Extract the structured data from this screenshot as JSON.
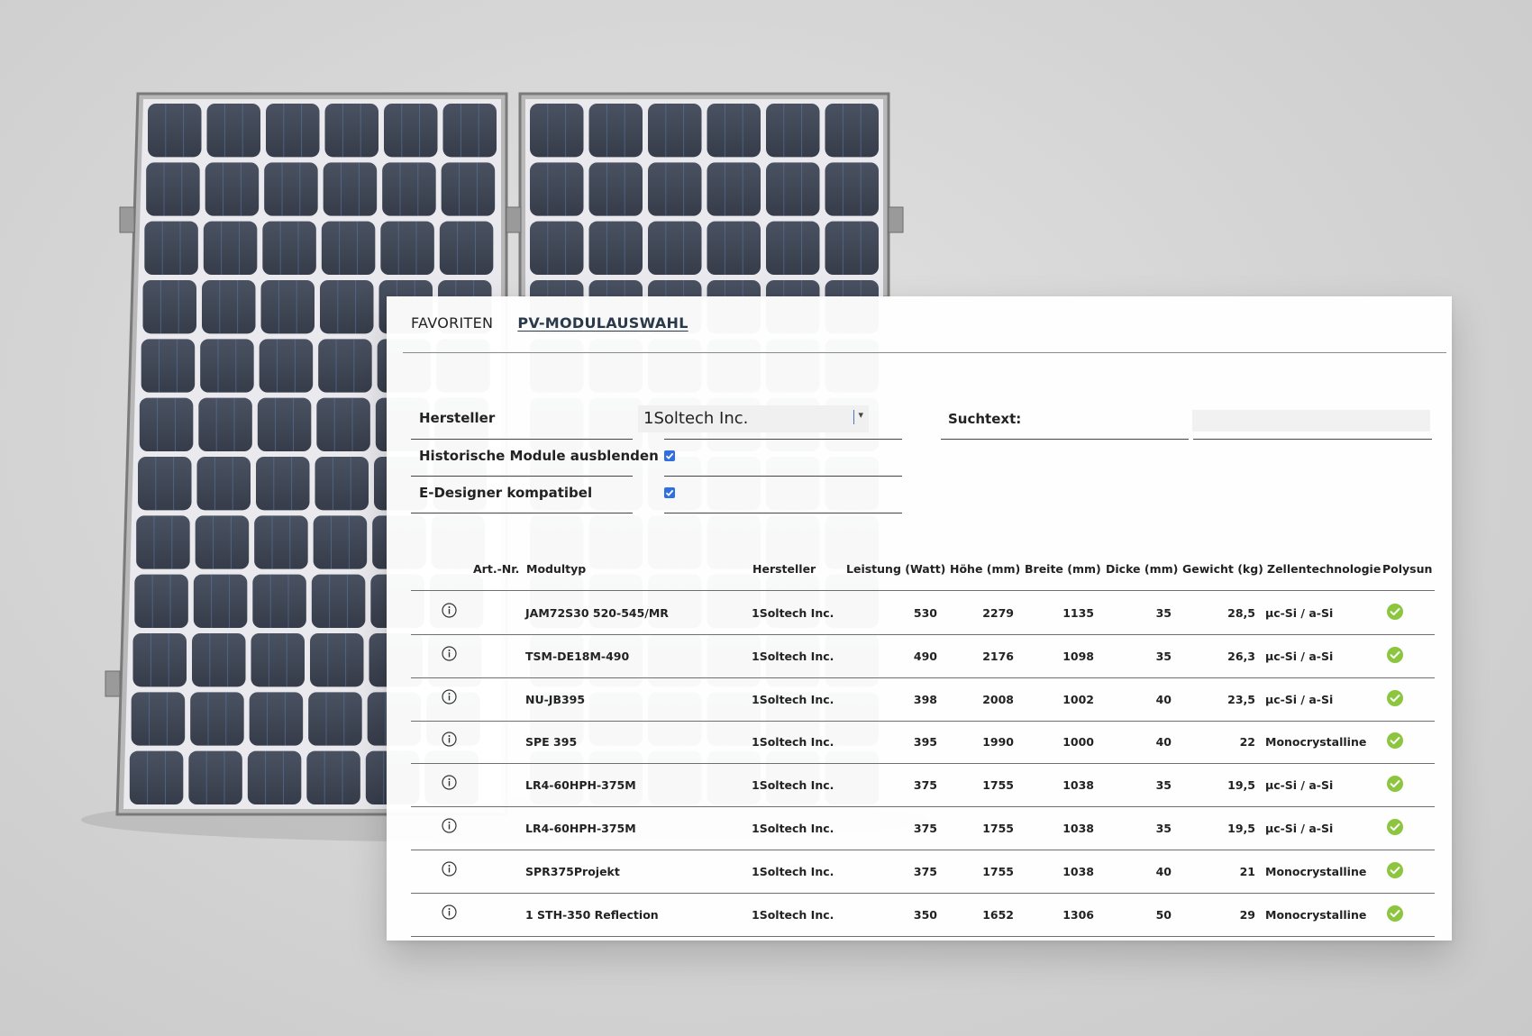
{
  "tabs": [
    {
      "label": "FAVORITEN",
      "active": false
    },
    {
      "label": "PV-MODULAUSWAHL",
      "active": true
    }
  ],
  "filters": {
    "manufacturer_label": "Hersteller",
    "manufacturer_value": "1Soltech Inc.",
    "search_label": "Suchtext:",
    "search_value": "",
    "hide_historic_label": "Historische Module ausblenden",
    "hide_historic_checked": true,
    "edesigner_label": "E-Designer kompatibel",
    "edesigner_checked": true
  },
  "table": {
    "columns": [
      "Art.-Nr.",
      "Modultyp",
      "Hersteller",
      "Leistung (Watt)",
      "Höhe (mm)",
      "Breite (mm)",
      "Dicke (mm)",
      "Gewicht (kg)",
      "Zellentechnologie",
      "Polysun"
    ],
    "rows": [
      {
        "modultyp": "JAM72S30 520-545/MR",
        "hersteller": "1Soltech Inc.",
        "leistung": "530",
        "hoehe": "2279",
        "breite": "1135",
        "dicke": "35",
        "gewicht": "28,5",
        "zellentechnologie": "µc-Si / a-Si",
        "polysun": "check-circle-icon"
      },
      {
        "modultyp": "TSM-DE18M-490",
        "hersteller": "1Soltech Inc.",
        "leistung": "490",
        "hoehe": "2176",
        "breite": "1098",
        "dicke": "35",
        "gewicht": "26,3",
        "zellentechnologie": "µc-Si / a-Si",
        "polysun": "check-circle-icon"
      },
      {
        "modultyp": "NU-JB395",
        "hersteller": "1Soltech Inc.",
        "leistung": "398",
        "hoehe": "2008",
        "breite": "1002",
        "dicke": "40",
        "gewicht": "23,5",
        "zellentechnologie": "µc-Si / a-Si",
        "polysun": "check-circle-icon"
      },
      {
        "modultyp": "SPE 395",
        "hersteller": "1Soltech Inc.",
        "leistung": "395",
        "hoehe": "1990",
        "breite": "1000",
        "dicke": "40",
        "gewicht": "22",
        "zellentechnologie": "Monocrystalline",
        "polysun": "check-circle-icon"
      },
      {
        "modultyp": "LR4-60HPH-375M",
        "hersteller": "1Soltech Inc.",
        "leistung": "375",
        "hoehe": "1755",
        "breite": "1038",
        "dicke": "35",
        "gewicht": "19,5",
        "zellentechnologie": "µc-Si / a-Si",
        "polysun": "check-circle-icon"
      },
      {
        "modultyp": "LR4-60HPH-375M",
        "hersteller": "1Soltech Inc.",
        "leistung": "375",
        "hoehe": "1755",
        "breite": "1038",
        "dicke": "35",
        "gewicht": "19,5",
        "zellentechnologie": "µc-Si / a-Si",
        "polysun": "check-circle-icon"
      },
      {
        "modultyp": "SPR375Projekt",
        "hersteller": "1Soltech Inc.",
        "leistung": "375",
        "hoehe": "1755",
        "breite": "1038",
        "dicke": "40",
        "gewicht": "21",
        "zellentechnologie": "Monocrystalline",
        "polysun": "check-circle-icon"
      },
      {
        "modultyp": "1 STH-350 Reflection",
        "hersteller": "1Soltech Inc.",
        "leistung": "350",
        "hoehe": "1652",
        "breite": "1306",
        "dicke": "50",
        "gewicht": "29",
        "zellentechnologie": "Monocrystalline",
        "polysun": "check-circle-icon"
      }
    ]
  },
  "colors": {
    "accent_blue": "#2f6fe0",
    "check_green": "#8cc63f",
    "panel_cell": "#3f4656"
  }
}
